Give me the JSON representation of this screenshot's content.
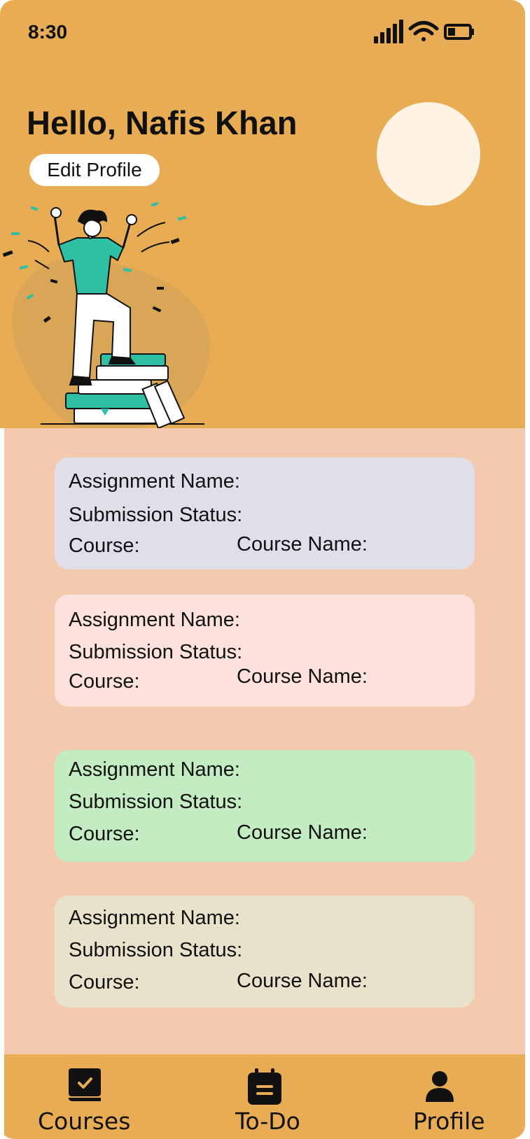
{
  "status_bar": {
    "time": "8:30"
  },
  "header": {
    "greeting": "Hello, Nafis Khan",
    "edit_profile_label": "Edit Profile"
  },
  "assignments": [
    {
      "name_label": "Assignment Name:",
      "status_label": "Submission Status:",
      "course_label": "Course:",
      "course_name_label": "Course Name:",
      "color": "#e0dee9"
    },
    {
      "name_label": "Assignment Name:",
      "status_label": "Submission Status:",
      "course_label": "Course:",
      "course_name_label": "Course Name:",
      "color": "#fde1dc"
    },
    {
      "name_label": "Assignment Name:",
      "status_label": "Submission Status:",
      "course_label": "Course:",
      "course_name_label": "Course Name:",
      "color": "#c4ecc2"
    },
    {
      "name_label": "Assignment Name:",
      "status_label": "Submission Status:",
      "course_label": "Course:",
      "course_name_label": "Course Name:",
      "color": "#e8e2ca"
    }
  ],
  "bottom_nav": [
    {
      "label": "Courses",
      "icon": "book-check-icon"
    },
    {
      "label": "To-Do",
      "icon": "calendar-list-icon"
    },
    {
      "label": "Profile",
      "icon": "person-icon"
    }
  ],
  "colors": {
    "header_bg": "#e8ac55",
    "content_bg": "#f3caae",
    "accent_teal": "#2fbfa5"
  }
}
